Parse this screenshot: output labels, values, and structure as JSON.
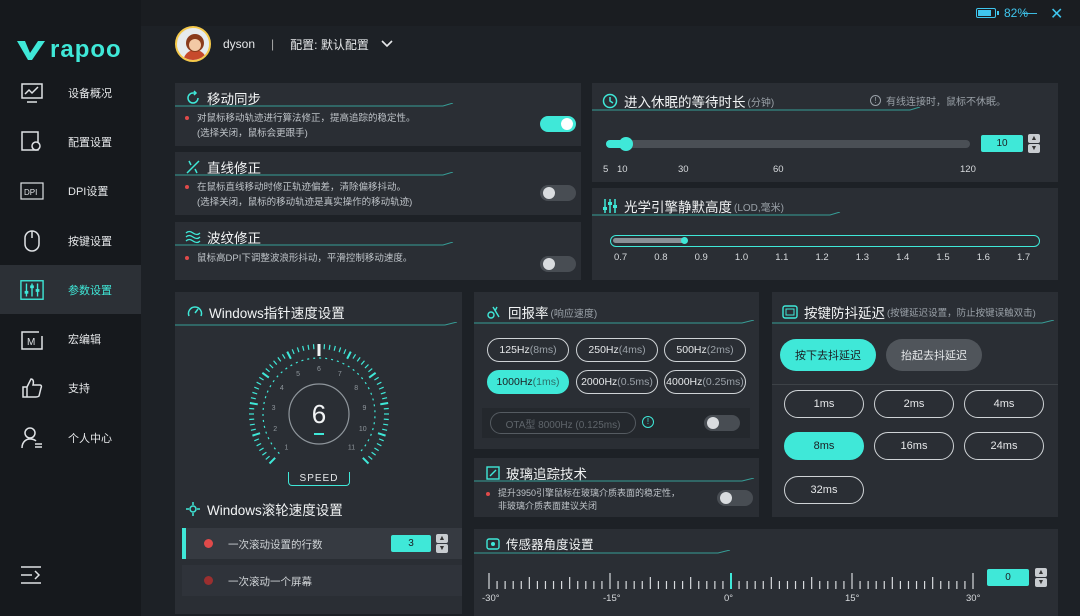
{
  "brand": {
    "logo": "rapoo"
  },
  "status": {
    "battery": "82%"
  },
  "user": {
    "name": "dyson",
    "separator": "|",
    "profile": "配置: 默认配置"
  },
  "nav": [
    {
      "label": "设备概况",
      "icon": "monitor-chart-icon"
    },
    {
      "label": "配置设置",
      "icon": "config-gear-icon"
    },
    {
      "label": "DPI设置",
      "icon": "dpi-icon"
    },
    {
      "label": "按键设置",
      "icon": "mouse-icon"
    },
    {
      "label": "参数设置",
      "icon": "sliders-icon",
      "active": true
    },
    {
      "label": "宏编辑",
      "icon": "macro-icon"
    },
    {
      "label": "支持",
      "icon": "thumbs-up-icon"
    },
    {
      "label": "个人中心",
      "icon": "user-icon"
    }
  ],
  "motion_sync": {
    "title": "移动同步",
    "desc1": "对鼠标移动轨迹进行算法修正，提高追踪的稳定性。",
    "desc2": "(选择关闭，鼠标会更跟手)",
    "enabled": true
  },
  "angle_snap": {
    "title": "直线修正",
    "desc1": "在鼠标直线移动时修正轨迹偏差，清除偏移抖动。",
    "desc2": "(选择关闭，鼠标的移动轨迹是真实操作的移动轨迹)",
    "enabled": false
  },
  "ripple": {
    "title": "波纹修正",
    "desc1": "鼠标高DPI下调整波浪形抖动，平滑控制移动速度。",
    "enabled": false
  },
  "sleep": {
    "title": "进入休眠的等待时长",
    "unit": "(分钟)",
    "hint": "有线连接时，鼠标不休眠。",
    "value": "10",
    "ticks": [
      "5",
      "10",
      "30",
      "60",
      "120"
    ],
    "fill_fraction": 0.04
  },
  "lod": {
    "title": "光学引擎静默高度",
    "unit": "(LOD,毫米)",
    "ticks": [
      "0.7",
      "0.8",
      "0.9",
      "1.0",
      "1.1",
      "1.2",
      "1.3",
      "1.4",
      "1.5",
      "1.6",
      "1.7"
    ],
    "value": 0.8
  },
  "pointer": {
    "title": "Windows指针速度设置",
    "value": "6",
    "label": "SPEED",
    "dial_numbers": [
      "1",
      "2",
      "3",
      "4",
      "5",
      "6",
      "7",
      "8",
      "9",
      "10",
      "11"
    ]
  },
  "scroll": {
    "title": "Windows滚轮速度设置",
    "opt1": "一次滚动设置的行数",
    "opt1_value": "3",
    "opt2": "一次滚动一个屏幕"
  },
  "polling": {
    "title": "回报率",
    "subtitle": "(响应速度)",
    "options": [
      {
        "rate": "125Hz",
        "ms": "(8ms)"
      },
      {
        "rate": "250Hz",
        "ms": "(4ms)"
      },
      {
        "rate": "500Hz",
        "ms": "(2ms)"
      },
      {
        "rate": "1000Hz",
        "ms": "(1ms)",
        "selected": true
      },
      {
        "rate": "2000Hz",
        "ms": "(0.5ms)"
      },
      {
        "rate": "4000Hz",
        "ms": "(0.25ms)"
      }
    ],
    "ota": "OTA型 8000Hz (0.125ms)",
    "ota_enabled": false
  },
  "debounce": {
    "title": "按键防抖延迟",
    "subtitle": "(按键延迟设置，防止按键误触双击)",
    "press": "按下去抖延迟",
    "release": "抬起去抖延迟",
    "values": [
      "1ms",
      "2ms",
      "4ms",
      "8ms",
      "16ms",
      "24ms",
      "32ms"
    ],
    "selected": "8ms"
  },
  "glass": {
    "title": "玻璃追踪技术",
    "desc1": "提升3950引擎鼠标在玻璃介质表面的稳定性，",
    "desc2": "非玻璃介质表面建议关闭",
    "enabled": false
  },
  "angle": {
    "title": "传感器角度设置",
    "value": "0",
    "ticks": [
      "-30°",
      "-15°",
      "0°",
      "15°",
      "30°"
    ]
  }
}
